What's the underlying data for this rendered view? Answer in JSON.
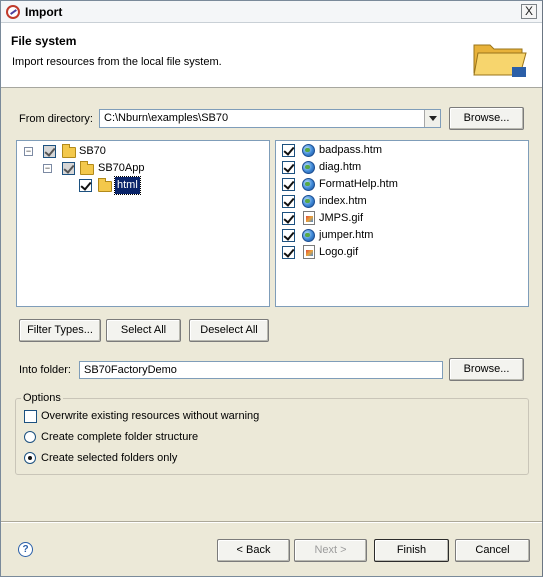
{
  "window": {
    "title": "Import",
    "close_label": "X"
  },
  "header": {
    "title": "File system",
    "description": "Import resources from the local file system."
  },
  "from_directory": {
    "label": "From directory:",
    "value": "C:\\Nburn\\examples\\SB70",
    "browse_label": "Browse..."
  },
  "tree": {
    "items": [
      {
        "label": "SB70",
        "state": "partial",
        "expanded": true
      },
      {
        "label": "SB70App",
        "state": "partial",
        "expanded": true
      },
      {
        "label": "html",
        "state": "checked",
        "selected": true
      }
    ]
  },
  "files": [
    {
      "name": "badpass.htm",
      "icon": "web-page-icon",
      "checked": true
    },
    {
      "name": "diag.htm",
      "icon": "web-page-icon",
      "checked": true
    },
    {
      "name": "FormatHelp.htm",
      "icon": "web-page-icon",
      "checked": true
    },
    {
      "name": "index.htm",
      "icon": "web-page-icon",
      "checked": true
    },
    {
      "name": "JMPS.gif",
      "icon": "image-file-icon",
      "checked": true
    },
    {
      "name": "jumper.htm",
      "icon": "web-page-icon",
      "checked": true
    },
    {
      "name": "Logo.gif",
      "icon": "image-file-icon",
      "checked": true
    }
  ],
  "selection_buttons": {
    "filter_types": "Filter Types...",
    "select_all": "Select All",
    "deselect_all": "Deselect All"
  },
  "into_folder": {
    "label": "Into folder:",
    "value": "SB70FactoryDemo",
    "browse_label": "Browse..."
  },
  "options": {
    "title": "Options",
    "overwrite": {
      "label": "Overwrite existing resources without warning",
      "checked": false
    },
    "radios": [
      {
        "label": "Create complete folder structure",
        "selected": false
      },
      {
        "label": "Create selected folders only",
        "selected": true
      }
    ]
  },
  "footer": {
    "help_label": "?",
    "back": "< Back",
    "next": "Next >",
    "finish": "Finish",
    "cancel": "Cancel"
  },
  "colors": {
    "dialog_bg": "#ece9d8",
    "selection": "#0a246a",
    "folder": "#f3c84b"
  }
}
